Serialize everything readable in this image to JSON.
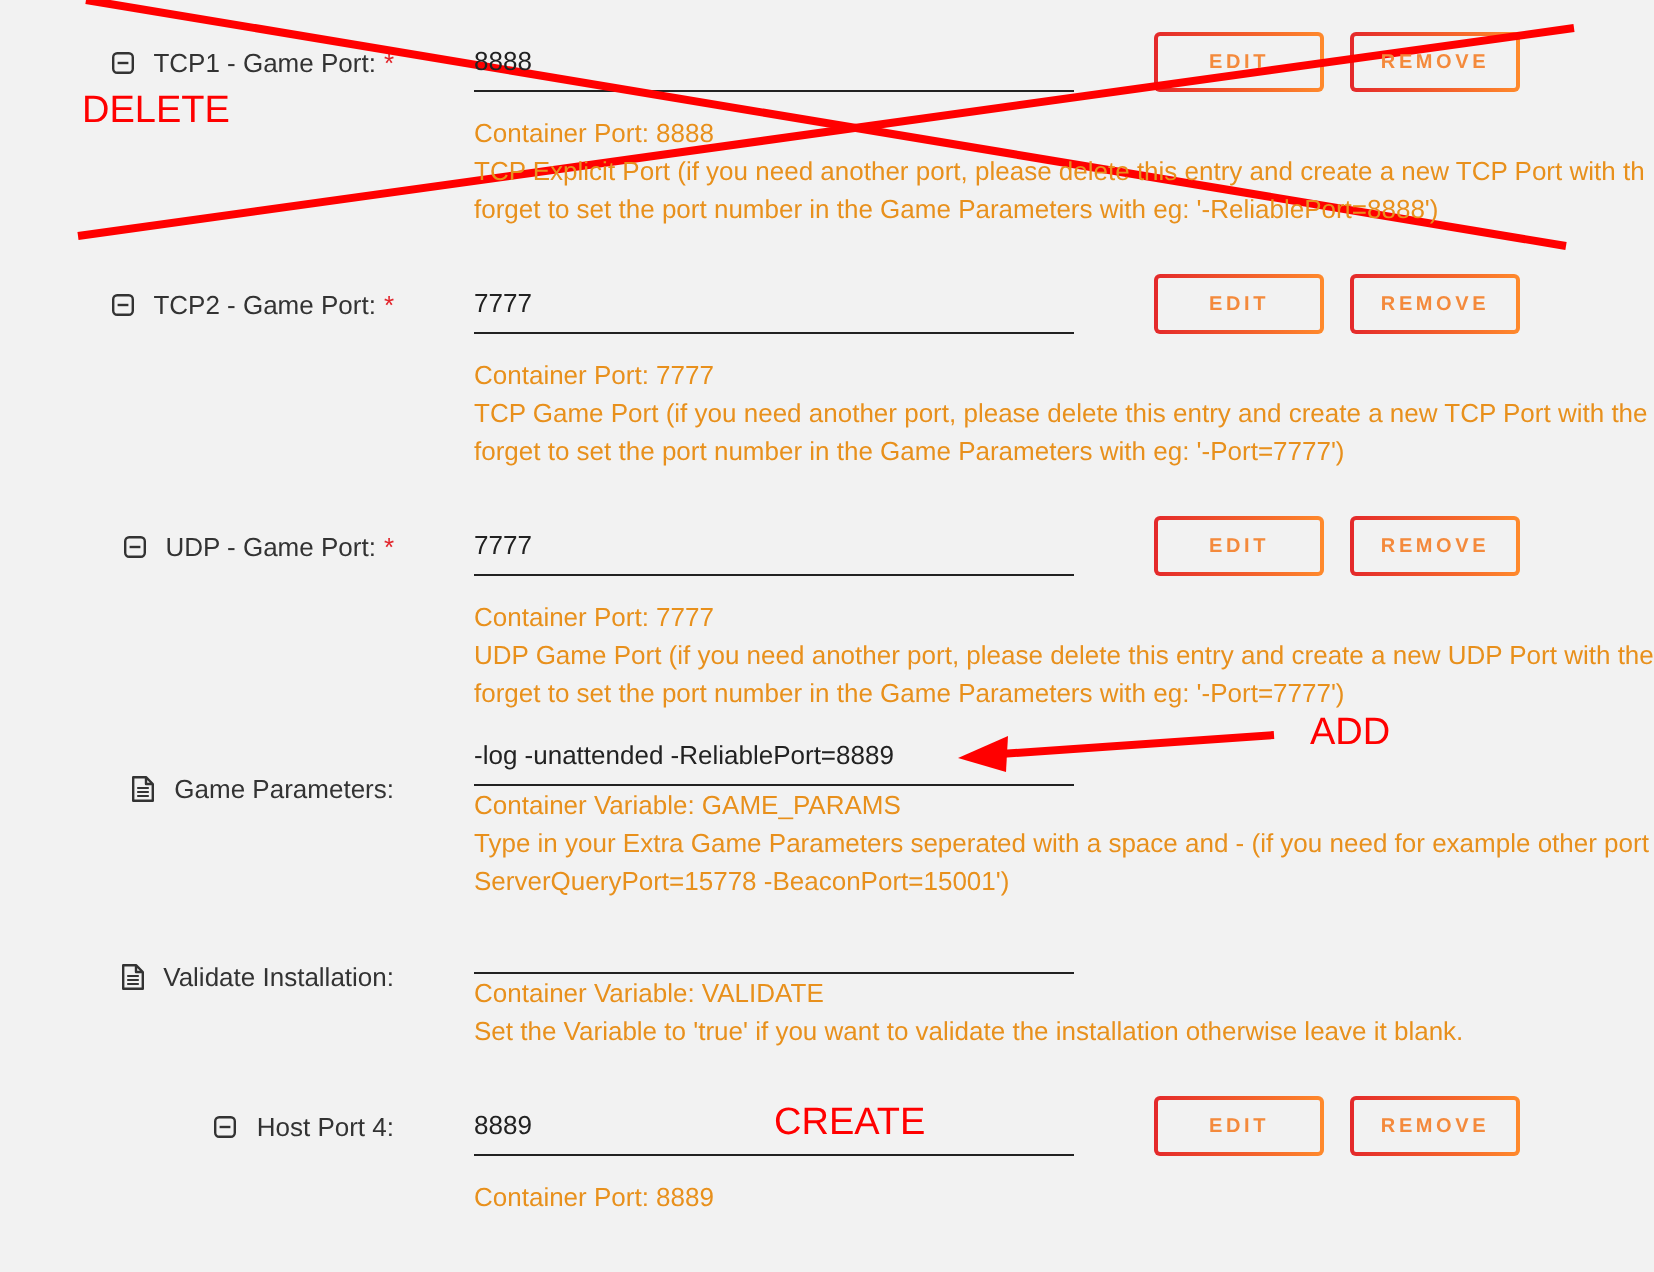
{
  "rows": [
    {
      "kind": "port",
      "label": "TCP1 - Game Port:",
      "required_mark": "*",
      "value": "8888",
      "buttons": [
        {
          "label": "EDIT"
        },
        {
          "label": "REMOVE"
        }
      ],
      "note": "Container Port: 8888",
      "description": [
        "TCP Explicit Port (if you need another port, please delete this entry and create a new TCP Port with th",
        "forget to set the port number in the Game Parameters with eg: '-ReliablePort=8888')"
      ],
      "annotation": {
        "kind": "cross",
        "label": "DELETE"
      }
    },
    {
      "kind": "port",
      "label": "TCP2 - Game Port:",
      "required_mark": "*",
      "value": "7777",
      "buttons": [
        {
          "label": "EDIT"
        },
        {
          "label": "REMOVE"
        }
      ],
      "note": "Container Port: 7777",
      "description": [
        "TCP Game Port (if you need another port, please delete this entry and create a new TCP Port with the",
        "forget to set the port number in the Game Parameters with eg: '-Port=7777')"
      ]
    },
    {
      "kind": "port",
      "label": "UDP - Game Port:",
      "required_mark": "*",
      "value": "7777",
      "buttons": [
        {
          "label": "EDIT"
        },
        {
          "label": "REMOVE"
        }
      ],
      "note": "Container Port: 7777",
      "description": [
        "UDP Game Port (if you need another port, please delete this entry and create a new UDP Port with the",
        "forget to set the port number in the Game Parameters with eg: '-Port=7777')"
      ]
    },
    {
      "kind": "variable",
      "label": "Game Parameters:",
      "value": "-log -unattended -ReliablePort=8889",
      "note": "Container Variable: GAME_PARAMS",
      "description": [
        "Type in your Extra Game Parameters seperated with a space and - (if you need for example other port",
        "ServerQueryPort=15778 -BeaconPort=15001')"
      ],
      "annotation": {
        "kind": "arrow",
        "label": "ADD"
      }
    },
    {
      "kind": "variable",
      "label": "Validate Installation:",
      "note": "Container Variable: VALIDATE",
      "description": [
        "Set the Variable to 'true' if you want to validate the installation otherwise leave it blank."
      ]
    },
    {
      "kind": "port",
      "label": "Host Port 4:",
      "value": "8889",
      "buttons": [
        {
          "label": "EDIT"
        },
        {
          "label": "REMOVE"
        }
      ],
      "note": "Container Port: 8889",
      "annotation": {
        "kind": "text",
        "label": "CREATE"
      }
    }
  ]
}
